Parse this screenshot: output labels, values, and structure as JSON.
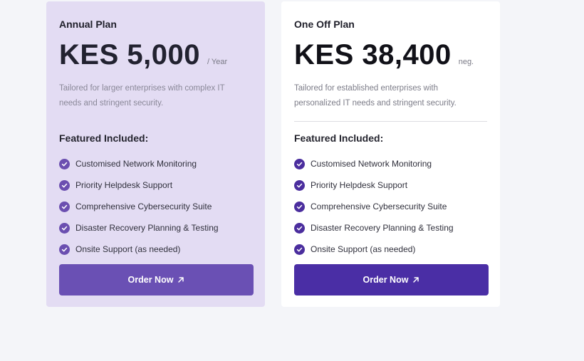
{
  "plans": [
    {
      "name": "Annual Plan",
      "price": "KES 5,000",
      "period": "/ Year",
      "description": "Tailored for larger enterprises with complex IT needs and stringent security.",
      "features_title": "Featured Included:",
      "features": [
        "Customised Network Monitoring",
        "Priority Helpdesk Support",
        "Comprehensive Cybersecurity Suite",
        "Disaster Recovery Planning & Testing",
        "Onsite Support (as needed)"
      ],
      "button_label": "Order Now",
      "button_icon": "arrow-up-right-icon",
      "accent_color": "#6a50b4"
    },
    {
      "name": "One Off Plan",
      "price": "KES 38,400",
      "period": "neg.",
      "description": "Tailored for established enterprises with personalized IT needs and stringent security.",
      "features_title": "Featured Included:",
      "features": [
        "Customised Network Monitoring",
        "Priority Helpdesk Support",
        "Comprehensive Cybersecurity Suite",
        "Disaster Recovery Planning & Testing",
        "Onsite Support (as needed)"
      ],
      "button_label": "Order Now",
      "button_icon": "arrow-up-right-icon",
      "accent_color": "#4a2ea5"
    }
  ]
}
